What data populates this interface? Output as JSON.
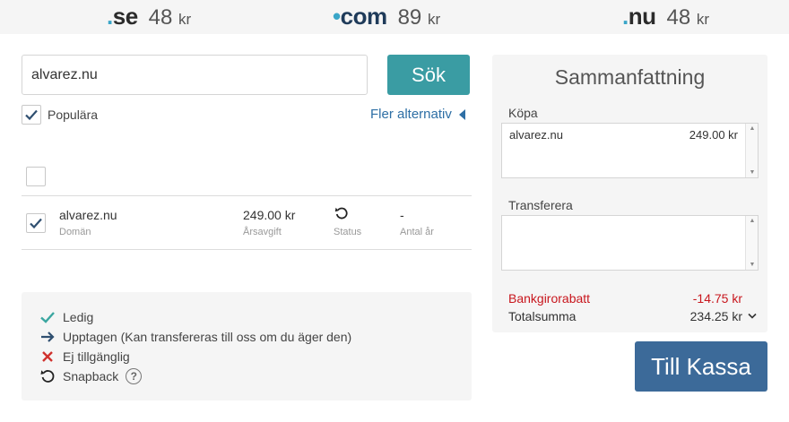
{
  "tlds": [
    {
      "name": "se",
      "price": "48",
      "currency": "kr"
    },
    {
      "name": "com",
      "price": "89",
      "currency": "kr"
    },
    {
      "name": "nu",
      "price": "48",
      "currency": "kr"
    }
  ],
  "search": {
    "value": "alvarez.nu",
    "button_label": "Sök"
  },
  "filters": {
    "popular_label": "Populära",
    "popular_checked": true,
    "more_options_label": "Fler alternativ"
  },
  "results": {
    "select_all_checked": false,
    "rows": [
      {
        "checked": true,
        "domain": "alvarez.nu",
        "domain_sub": "Domän",
        "price": "249.00 kr",
        "price_sub": "Årsavgift",
        "status_icon": "snapback-icon",
        "status_sub": "Status",
        "years": "-",
        "years_sub": "Antal år"
      }
    ]
  },
  "legend": [
    {
      "icon": "check-icon",
      "label": "Ledig"
    },
    {
      "icon": "arrow-right-icon",
      "label": "Upptagen (Kan transfereras till oss om du äger den)"
    },
    {
      "icon": "cross-icon",
      "label": "Ej tillgänglig"
    },
    {
      "icon": "snapback-icon",
      "label": "Snapback",
      "help": "?"
    }
  ],
  "summary": {
    "title": "Sammanfattning",
    "buy_label": "Köpa",
    "buy_items": [
      {
        "domain": "alvarez.nu",
        "price": "249.00 kr"
      }
    ],
    "transfer_label": "Transferera",
    "discount_label": "Bankgirorabatt",
    "discount_value": "-14.75 kr",
    "total_label": "Totalsumma",
    "total_value": "234.25 kr"
  },
  "checkout": {
    "label": "Till Kassa"
  },
  "colors": {
    "accent_teal": "#3a9ca3",
    "checkout_blue": "#3c6a99",
    "link_blue": "#2e6fa5",
    "discount_red": "#c8161d",
    "check_teal": "#3aa6a0",
    "cross_red": "#d0312d"
  }
}
